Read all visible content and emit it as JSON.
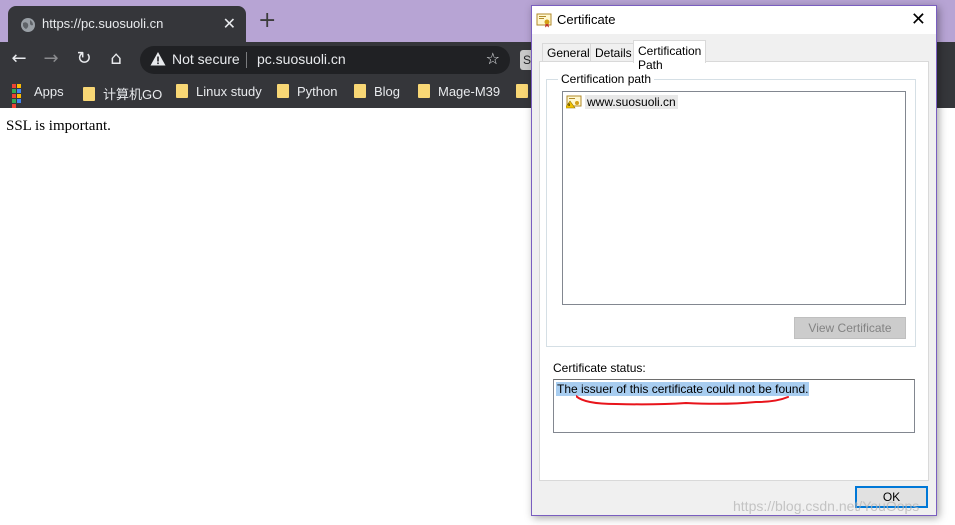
{
  "browser": {
    "tab_title": "https://pc.suosuoli.cn",
    "tab_close": "✕",
    "new_tab": "+",
    "back": "←",
    "forward": "→",
    "reload": "↻",
    "home": "⌂",
    "security_label": "Not secure",
    "url": "pc.suosuoli.cn",
    "star": "☆",
    "extension_letter": "S",
    "bookmarks": [
      "Apps",
      "计算机GO",
      "Linux study",
      "Python",
      "Blog",
      "Mage-M39"
    ]
  },
  "page": {
    "body_text": "SSL is important."
  },
  "dialog": {
    "title": "Certificate",
    "close": "✕",
    "tabs": [
      "General",
      "Details",
      "Certification Path"
    ],
    "active_tab": "Certification Path",
    "cert_path_label": "Certification path",
    "tree_items": [
      "www.suosuoli.cn"
    ],
    "view_certificate_label": "View Certificate",
    "status_label": "Certificate status:",
    "status_text": "The issuer of this certificate could not be found.",
    "ok_label": "OK"
  },
  "watermark": "https://blog.csdn.net/YouOops",
  "colors": {
    "titlebar_accent": "#b7a4d4",
    "chrome_dark": "#35363a",
    "selection": "#a8cdf0",
    "annotation_red": "#e8141b",
    "ok_border": "#0078d7"
  },
  "icons": {
    "tab_favicon": "globe-icon",
    "security": "warning-icon",
    "certificate": "certificate-icon",
    "bookmark": "folder-icon"
  }
}
